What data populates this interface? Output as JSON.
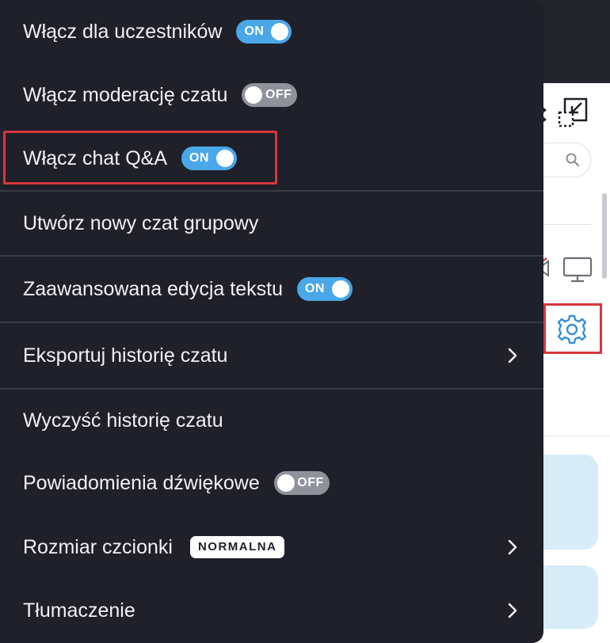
{
  "menu": {
    "items": [
      {
        "label": "Włącz dla uczestników",
        "toggle": "ON"
      },
      {
        "label": "Włącz moderację czatu",
        "toggle": "OFF"
      },
      {
        "label": "Włącz chat Q&A",
        "toggle": "ON"
      },
      {
        "label": "Utwórz nowy czat grupowy"
      },
      {
        "label": "Zaawansowana edycja tekstu",
        "toggle": "ON"
      },
      {
        "label": "Eksportuj historię czatu"
      },
      {
        "label": "Wyczyść historię czatu"
      },
      {
        "label": "Powiadomienia dźwiękowe",
        "toggle": "OFF"
      },
      {
        "label": "Rozmiar czcionki",
        "badge": "NORMALNA"
      },
      {
        "label": "Tłumaczenie"
      }
    ]
  },
  "icons": {
    "submenu_arrow": "chevron-right-icon",
    "settings": "gear-icon",
    "search": "search-icon",
    "screen_share": "monitor-icon",
    "exit_fullscreen": "exit-fullscreen-icon"
  },
  "colors": {
    "menu_background": "#1f2029",
    "toggle_on": "#4aa7e8",
    "toggle_off": "#8f929b",
    "highlight": "#d9363e",
    "chat_bubble": "#d6ecf7"
  }
}
